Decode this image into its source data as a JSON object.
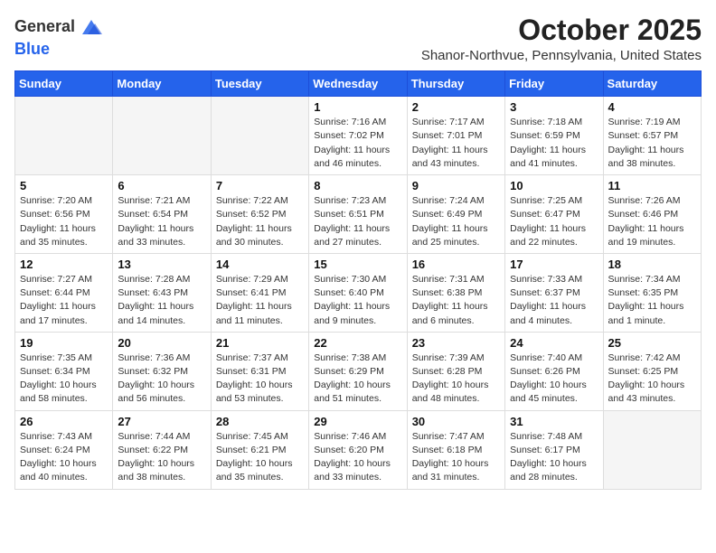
{
  "logo": {
    "general": "General",
    "blue": "Blue"
  },
  "header": {
    "title": "October 2025",
    "location": "Shanor-Northvue, Pennsylvania, United States"
  },
  "weekdays": [
    "Sunday",
    "Monday",
    "Tuesday",
    "Wednesday",
    "Thursday",
    "Friday",
    "Saturday"
  ],
  "weeks": [
    [
      {
        "day": "",
        "info": ""
      },
      {
        "day": "",
        "info": ""
      },
      {
        "day": "",
        "info": ""
      },
      {
        "day": "1",
        "info": "Sunrise: 7:16 AM\nSunset: 7:02 PM\nDaylight: 11 hours\nand 46 minutes."
      },
      {
        "day": "2",
        "info": "Sunrise: 7:17 AM\nSunset: 7:01 PM\nDaylight: 11 hours\nand 43 minutes."
      },
      {
        "day": "3",
        "info": "Sunrise: 7:18 AM\nSunset: 6:59 PM\nDaylight: 11 hours\nand 41 minutes."
      },
      {
        "day": "4",
        "info": "Sunrise: 7:19 AM\nSunset: 6:57 PM\nDaylight: 11 hours\nand 38 minutes."
      }
    ],
    [
      {
        "day": "5",
        "info": "Sunrise: 7:20 AM\nSunset: 6:56 PM\nDaylight: 11 hours\nand 35 minutes."
      },
      {
        "day": "6",
        "info": "Sunrise: 7:21 AM\nSunset: 6:54 PM\nDaylight: 11 hours\nand 33 minutes."
      },
      {
        "day": "7",
        "info": "Sunrise: 7:22 AM\nSunset: 6:52 PM\nDaylight: 11 hours\nand 30 minutes."
      },
      {
        "day": "8",
        "info": "Sunrise: 7:23 AM\nSunset: 6:51 PM\nDaylight: 11 hours\nand 27 minutes."
      },
      {
        "day": "9",
        "info": "Sunrise: 7:24 AM\nSunset: 6:49 PM\nDaylight: 11 hours\nand 25 minutes."
      },
      {
        "day": "10",
        "info": "Sunrise: 7:25 AM\nSunset: 6:47 PM\nDaylight: 11 hours\nand 22 minutes."
      },
      {
        "day": "11",
        "info": "Sunrise: 7:26 AM\nSunset: 6:46 PM\nDaylight: 11 hours\nand 19 minutes."
      }
    ],
    [
      {
        "day": "12",
        "info": "Sunrise: 7:27 AM\nSunset: 6:44 PM\nDaylight: 11 hours\nand 17 minutes."
      },
      {
        "day": "13",
        "info": "Sunrise: 7:28 AM\nSunset: 6:43 PM\nDaylight: 11 hours\nand 14 minutes."
      },
      {
        "day": "14",
        "info": "Sunrise: 7:29 AM\nSunset: 6:41 PM\nDaylight: 11 hours\nand 11 minutes."
      },
      {
        "day": "15",
        "info": "Sunrise: 7:30 AM\nSunset: 6:40 PM\nDaylight: 11 hours\nand 9 minutes."
      },
      {
        "day": "16",
        "info": "Sunrise: 7:31 AM\nSunset: 6:38 PM\nDaylight: 11 hours\nand 6 minutes."
      },
      {
        "day": "17",
        "info": "Sunrise: 7:33 AM\nSunset: 6:37 PM\nDaylight: 11 hours\nand 4 minutes."
      },
      {
        "day": "18",
        "info": "Sunrise: 7:34 AM\nSunset: 6:35 PM\nDaylight: 11 hours\nand 1 minute."
      }
    ],
    [
      {
        "day": "19",
        "info": "Sunrise: 7:35 AM\nSunset: 6:34 PM\nDaylight: 10 hours\nand 58 minutes."
      },
      {
        "day": "20",
        "info": "Sunrise: 7:36 AM\nSunset: 6:32 PM\nDaylight: 10 hours\nand 56 minutes."
      },
      {
        "day": "21",
        "info": "Sunrise: 7:37 AM\nSunset: 6:31 PM\nDaylight: 10 hours\nand 53 minutes."
      },
      {
        "day": "22",
        "info": "Sunrise: 7:38 AM\nSunset: 6:29 PM\nDaylight: 10 hours\nand 51 minutes."
      },
      {
        "day": "23",
        "info": "Sunrise: 7:39 AM\nSunset: 6:28 PM\nDaylight: 10 hours\nand 48 minutes."
      },
      {
        "day": "24",
        "info": "Sunrise: 7:40 AM\nSunset: 6:26 PM\nDaylight: 10 hours\nand 45 minutes."
      },
      {
        "day": "25",
        "info": "Sunrise: 7:42 AM\nSunset: 6:25 PM\nDaylight: 10 hours\nand 43 minutes."
      }
    ],
    [
      {
        "day": "26",
        "info": "Sunrise: 7:43 AM\nSunset: 6:24 PM\nDaylight: 10 hours\nand 40 minutes."
      },
      {
        "day": "27",
        "info": "Sunrise: 7:44 AM\nSunset: 6:22 PM\nDaylight: 10 hours\nand 38 minutes."
      },
      {
        "day": "28",
        "info": "Sunrise: 7:45 AM\nSunset: 6:21 PM\nDaylight: 10 hours\nand 35 minutes."
      },
      {
        "day": "29",
        "info": "Sunrise: 7:46 AM\nSunset: 6:20 PM\nDaylight: 10 hours\nand 33 minutes."
      },
      {
        "day": "30",
        "info": "Sunrise: 7:47 AM\nSunset: 6:18 PM\nDaylight: 10 hours\nand 31 minutes."
      },
      {
        "day": "31",
        "info": "Sunrise: 7:48 AM\nSunset: 6:17 PM\nDaylight: 10 hours\nand 28 minutes."
      },
      {
        "day": "",
        "info": ""
      }
    ]
  ]
}
